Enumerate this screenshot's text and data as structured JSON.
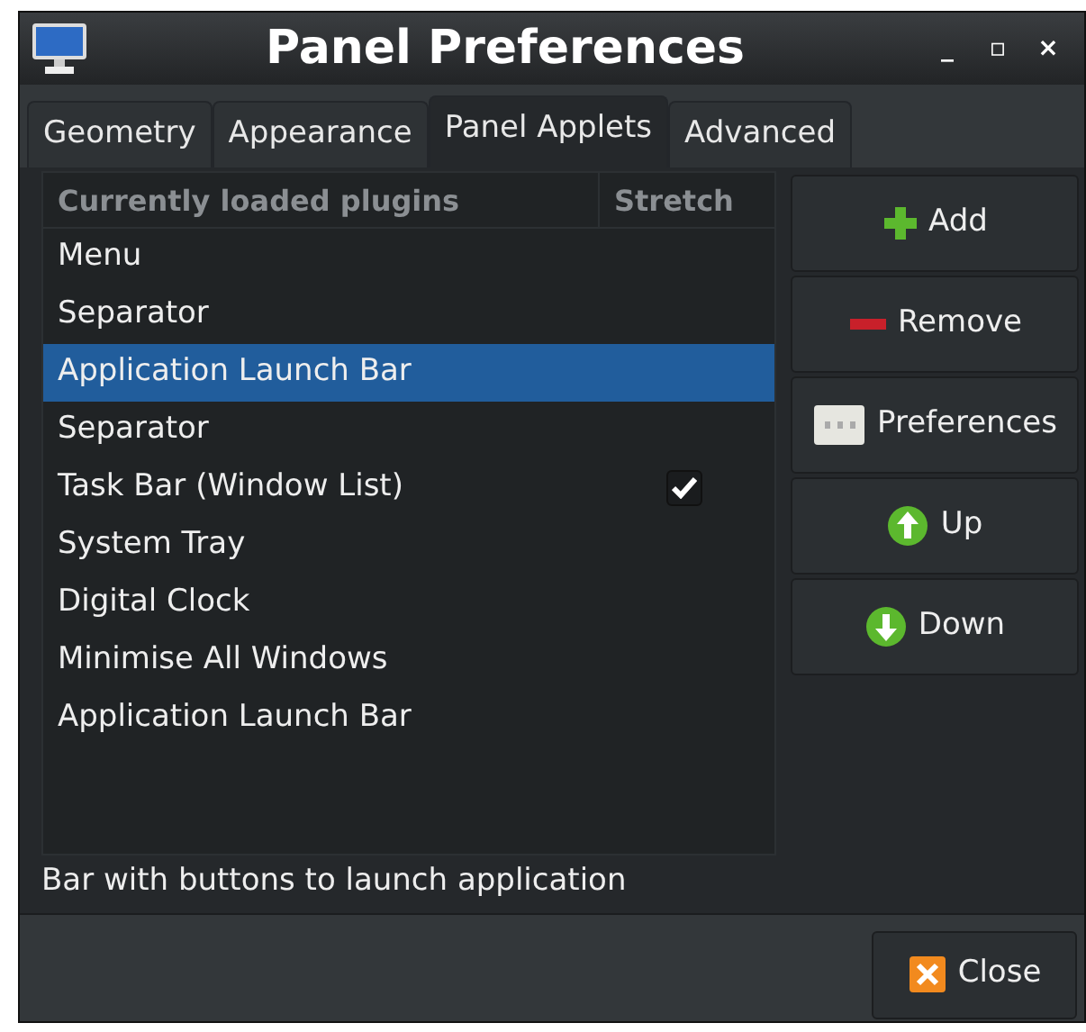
{
  "window": {
    "title": "Panel Preferences",
    "controls": [
      "_",
      "▫",
      "×"
    ]
  },
  "tabs": [
    {
      "label": "Geometry",
      "selected": false
    },
    {
      "label": "Appearance",
      "selected": false
    },
    {
      "label": "Panel Applets",
      "selected": true
    },
    {
      "label": "Advanced",
      "selected": false
    }
  ],
  "plugins": {
    "columns": [
      "Currently loaded plugins",
      "Stretch"
    ],
    "rows": [
      {
        "name": "Menu",
        "selected": false,
        "stretch": false
      },
      {
        "name": "Separator",
        "selected": false,
        "stretch": false
      },
      {
        "name": "Application Launch Bar",
        "selected": true,
        "stretch": false
      },
      {
        "name": "Separator",
        "selected": false,
        "stretch": false
      },
      {
        "name": "Task Bar (Window List)",
        "selected": false,
        "stretch": true
      },
      {
        "name": "System Tray",
        "selected": false,
        "stretch": false
      },
      {
        "name": "Digital Clock",
        "selected": false,
        "stretch": false
      },
      {
        "name": "Minimise All Windows",
        "selected": false,
        "stretch": false
      },
      {
        "name": "Application Launch Bar",
        "selected": false,
        "stretch": false
      }
    ]
  },
  "buttons": [
    {
      "label": "Add",
      "kind": "add"
    },
    {
      "label": "Remove",
      "kind": "remove"
    },
    {
      "label": "Preferences",
      "kind": "prefs"
    },
    {
      "label": "Up",
      "kind": "up"
    },
    {
      "label": "Down",
      "kind": "down"
    }
  ],
  "description": "Bar with buttons to launch application",
  "close_button": "Close"
}
